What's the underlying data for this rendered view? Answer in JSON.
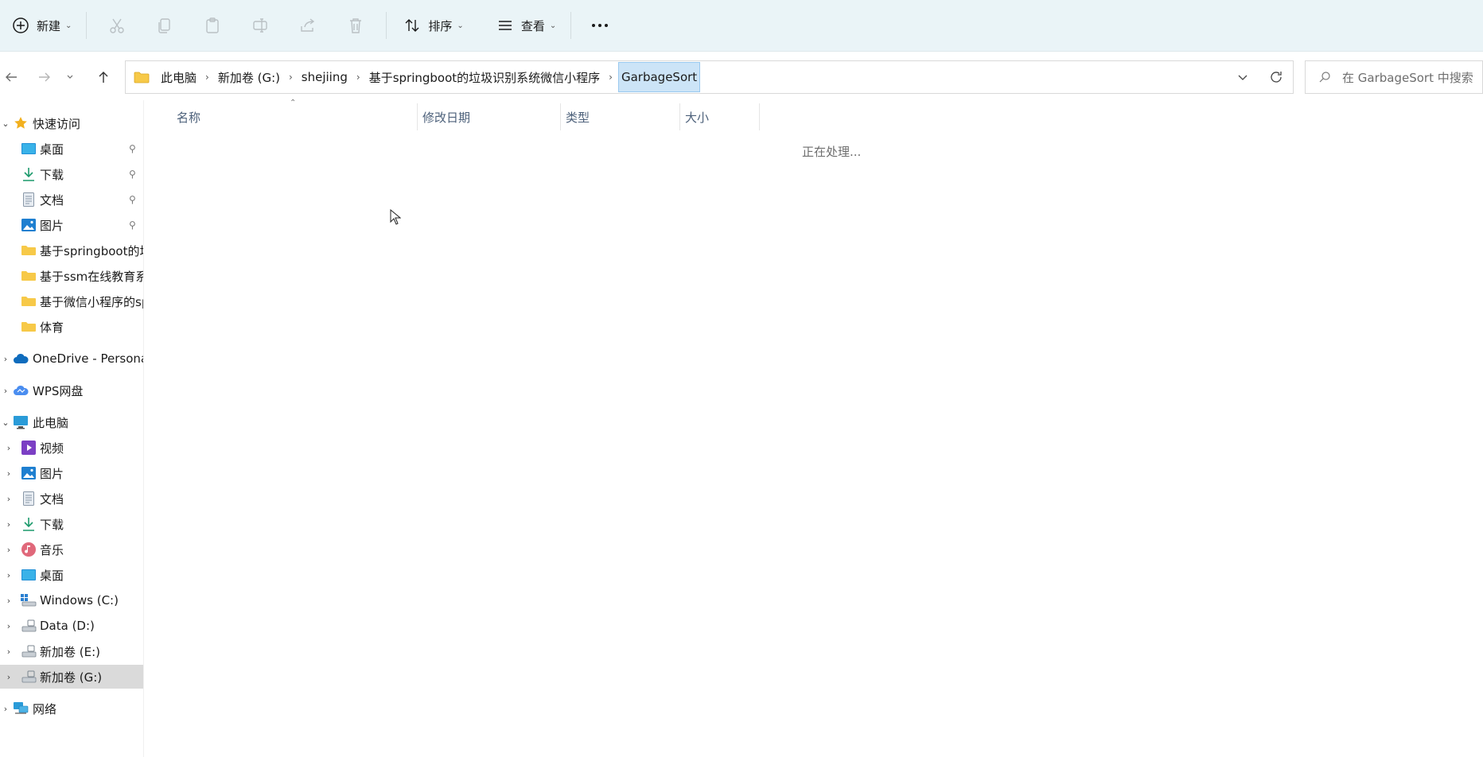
{
  "toolbar": {
    "new_label": "新建",
    "sort_label": "排序",
    "view_label": "查看",
    "icons": [
      "add-icon",
      "cut-icon",
      "copy-icon",
      "paste-icon",
      "rename-icon",
      "share-icon",
      "delete-icon",
      "sort-icon",
      "view-icon",
      "more-icon"
    ]
  },
  "breadcrumb": [
    "此电脑",
    "新加卷 (G:)",
    "shejiing",
    "基于springboot的垃圾识别系统微信小程序",
    "GarbageSort"
  ],
  "search": {
    "placeholder": "在 GarbageSort 中搜索"
  },
  "sidebar": {
    "quick_access": {
      "label": "快速访问",
      "items": [
        "桌面",
        "下载",
        "文档",
        "图片",
        "基于springboot的垃圾识别系统微信小程序",
        "基于ssm在线教育系统",
        "基于微信小程序的springboot",
        "体育"
      ]
    },
    "onedrive": "OneDrive - Personal",
    "wps": "WPS网盘",
    "this_pc": {
      "label": "此电脑",
      "items": [
        "视频",
        "图片",
        "文档",
        "下载",
        "音乐",
        "桌面",
        "Windows (C:)",
        "Data (D:)",
        "新加卷 (E:)",
        "新加卷 (G:)"
      ]
    },
    "network": "网络"
  },
  "columns": [
    "名称",
    "修改日期",
    "类型",
    "大小"
  ],
  "status_text": "正在处理...",
  "colors": {
    "toolbar_bg": "#eaf4f7",
    "selected_bg": "#dadada",
    "crumb_selected": "#cce4f7",
    "header_text": "#4c607a"
  }
}
